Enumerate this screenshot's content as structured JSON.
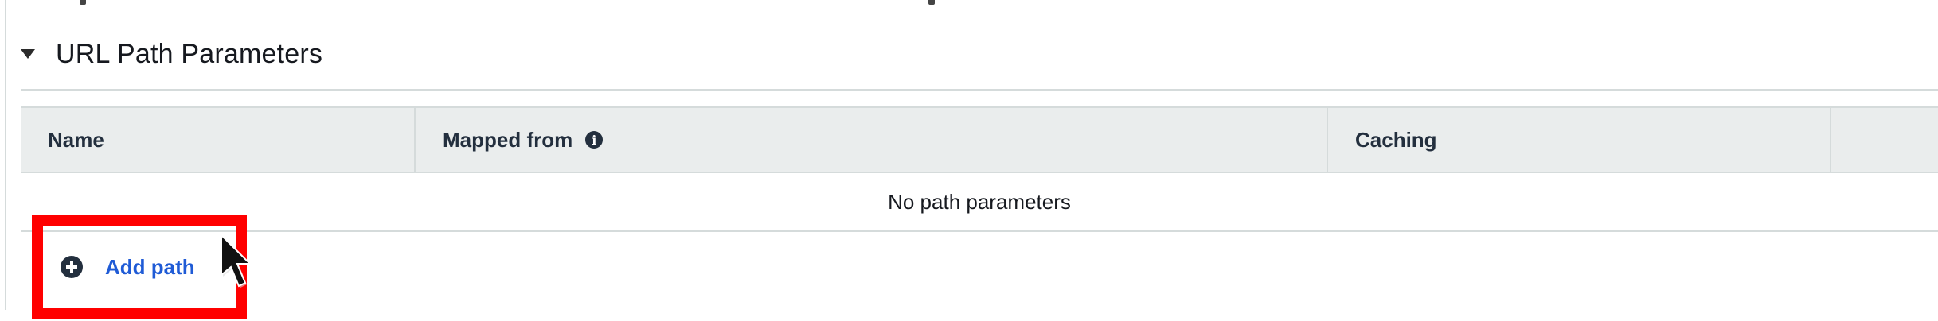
{
  "section": {
    "title": "URL Path Parameters",
    "expanded": true
  },
  "table": {
    "columns": [
      "Name",
      "Mapped from",
      "Caching",
      ""
    ],
    "empty_message": "No path parameters"
  },
  "actions": {
    "add_path_label": "Add path"
  },
  "icons": {
    "caret": "caret-down-icon",
    "info": "info-icon",
    "add": "plus-circle-icon",
    "cursor": "mouse-pointer-icon"
  },
  "colors": {
    "link": "#1f5bd6",
    "header_bg": "#eaeded",
    "border": "#d5dbdb",
    "highlight": "#ff0000"
  }
}
